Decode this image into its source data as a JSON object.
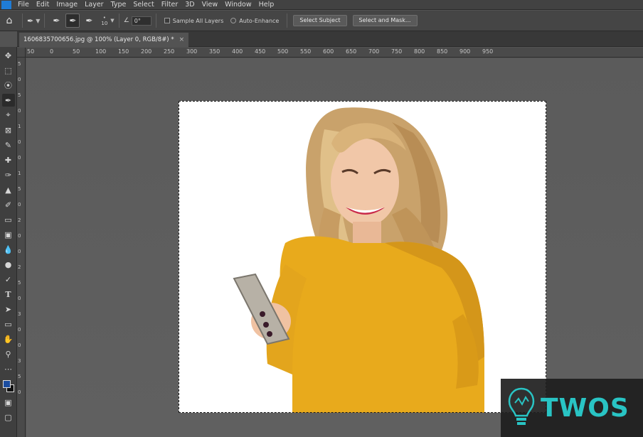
{
  "menu": {
    "items": [
      "File",
      "Edit",
      "Image",
      "Layer",
      "Type",
      "Select",
      "Filter",
      "3D",
      "View",
      "Window",
      "Help"
    ]
  },
  "options": {
    "brush_size": "10",
    "angle_value": "0°",
    "sample_all_layers": "Sample All Layers",
    "auto_enhance": "Auto-Enhance",
    "select_subject": "Select Subject",
    "select_and_mask": "Select and Mask..."
  },
  "document": {
    "tab_title": "1606835700656.jpg @ 100% (Layer 0, RGB/8#) *",
    "close_symbol": "×"
  },
  "ruler": {
    "top_labels": [
      "50",
      "0",
      "50",
      "100",
      "150",
      "200",
      "250",
      "300",
      "350",
      "400",
      "450",
      "500",
      "550",
      "600",
      "650",
      "700",
      "750",
      "800",
      "850",
      "900",
      "950"
    ],
    "left_labels": [
      "5",
      "0",
      "5",
      "0",
      "1",
      "0",
      "0",
      "1",
      "5",
      "0",
      "2",
      "0",
      "0",
      "2",
      "5",
      "0",
      "3",
      "0",
      "0",
      "3",
      "5",
      "0"
    ]
  },
  "toolbar": {
    "icons": [
      "move-icon",
      "marquee-icon",
      "lasso-icon",
      "quick-selection-icon",
      "crop-icon",
      "frame-icon",
      "eyedropper-icon",
      "healing-brush-icon",
      "brush-icon",
      "clone-stamp-icon",
      "history-brush-icon",
      "eraser-icon",
      "gradient-icon",
      "blur-icon",
      "dodge-icon",
      "pen-icon",
      "type-icon",
      "path-selection-icon",
      "rectangle-icon",
      "hand-icon",
      "zoom-icon",
      "more-icon"
    ],
    "foreground_color": "#1b4da0",
    "background_color": "#111111"
  },
  "watermark": {
    "text": "TWOS",
    "color": "#29c4c4"
  }
}
